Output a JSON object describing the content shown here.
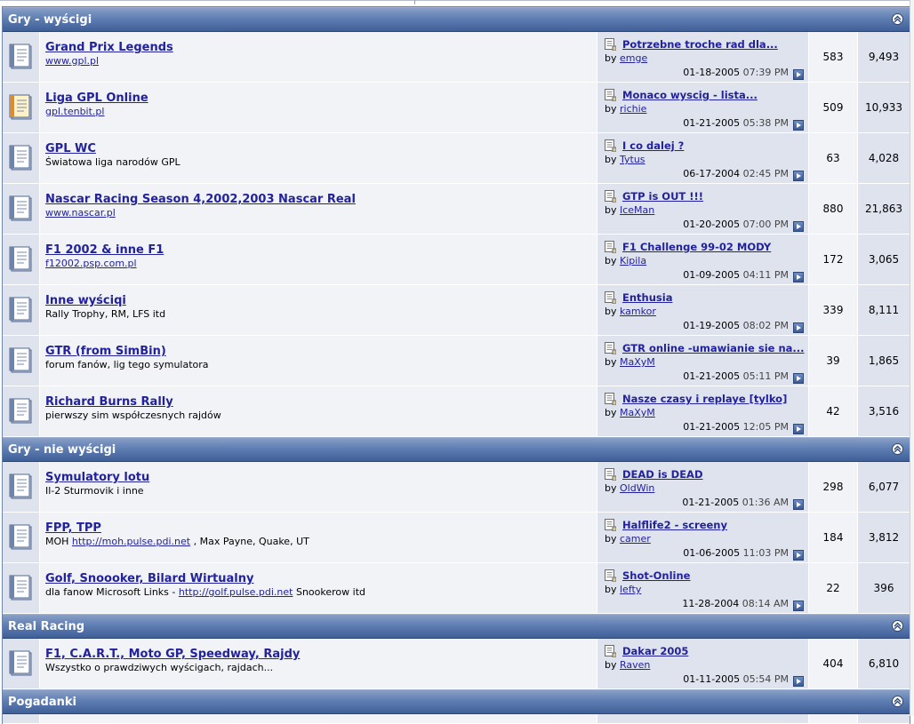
{
  "sections": [
    {
      "title": "Gry - wyścigi",
      "forums": [
        {
          "name": "Grand Prix Legends",
          "desc_link": "www.gpl.pl",
          "desc_text": "",
          "desc_after": "",
          "last_title": "Potrzebne troche rad dla...",
          "last_user": "emge",
          "last_date": "01-18-2005",
          "last_time": "07:39 PM",
          "threads": "583",
          "posts": "9,493",
          "icon": "forum-icon"
        },
        {
          "name": "Liga GPL Online",
          "desc_link": "gpl.tenbit.pl",
          "desc_text": "",
          "desc_after": "",
          "last_title": "Monaco wyscig - lista...",
          "last_user": "richie",
          "last_date": "01-21-2005",
          "last_time": "05:38 PM",
          "threads": "509",
          "posts": "10,933",
          "icon": "forum-new-posts-icon"
        },
        {
          "name": "GPL WC",
          "desc_link": "",
          "desc_text": "Światowa liga narodów GPL",
          "desc_after": "",
          "last_title": "I co dalej ?",
          "last_user": "Tytus",
          "last_date": "06-17-2004",
          "last_time": "02:45 PM",
          "threads": "63",
          "posts": "4,028",
          "icon": "forum-icon"
        },
        {
          "name": "Nascar Racing Season 4,2002,2003 Nascar Real",
          "desc_link": "www.nascar.pl",
          "desc_text": "",
          "desc_after": "",
          "last_title": "GTP is OUT !!!",
          "last_user": "IceMan",
          "last_date": "01-20-2005",
          "last_time": "07:00 PM",
          "threads": "880",
          "posts": "21,863",
          "icon": "forum-icon"
        },
        {
          "name": "F1 2002 & inne F1",
          "desc_link": "f12002.psp.com.pl",
          "desc_text": "",
          "desc_after": "",
          "last_title": "F1 Challenge 99-02 MODY",
          "last_user": "Kipila",
          "last_date": "01-09-2005",
          "last_time": "04:11 PM",
          "threads": "172",
          "posts": "3,065",
          "icon": "forum-icon"
        },
        {
          "name": "Inne wyściqi",
          "desc_link": "",
          "desc_text": "Rally Trophy, RM, LFS itd",
          "desc_after": "",
          "last_title": "Enthusia",
          "last_user": "kamkor",
          "last_date": "01-19-2005",
          "last_time": "08:02 PM",
          "threads": "339",
          "posts": "8,111",
          "icon": "forum-icon"
        },
        {
          "name": "GTR (from SimBin)",
          "desc_link": "",
          "desc_text": "forum fanów, lig tego symulatora",
          "desc_after": "",
          "last_title": "GTR online -umawianie sie na...",
          "last_user": "MaXyM",
          "last_date": "01-21-2005",
          "last_time": "05:11 PM",
          "threads": "39",
          "posts": "1,865",
          "icon": "forum-icon"
        },
        {
          "name": "Richard Burns Rally",
          "desc_link": "",
          "desc_text": "pierwszy sim współczesnych rajdów",
          "desc_after": "",
          "last_title": "Nasze czasy i replaye [tylko]",
          "last_user": "MaXyM",
          "last_date": "01-21-2005",
          "last_time": "12:05 PM",
          "threads": "42",
          "posts": "3,516",
          "icon": "forum-icon"
        }
      ]
    },
    {
      "title": "Gry - nie wyścigi",
      "forums": [
        {
          "name": "Symulatory lotu",
          "desc_link": "",
          "desc_text": "Il-2 Sturmovik i inne",
          "desc_after": "",
          "last_title": "DEAD is DEAD",
          "last_user": "OldWin",
          "last_date": "01-21-2005",
          "last_time": "01:36 AM",
          "threads": "298",
          "posts": "6,077",
          "icon": "forum-icon"
        },
        {
          "name": "FPP, TPP",
          "desc_link": "http://moh.pulse.pdi.net",
          "desc_text": "MOH ",
          "desc_after": " , Max Payne, Quake, UT",
          "last_title": "Halflife2 - screeny",
          "last_user": "camer",
          "last_date": "01-06-2005",
          "last_time": "11:03 PM",
          "threads": "184",
          "posts": "3,812",
          "icon": "forum-icon"
        },
        {
          "name": "Golf, Snoooker, Bilard Wirtualny",
          "desc_link": "http://golf.pulse.pdi.net",
          "desc_text": "dla fanow Microsoft Links - ",
          "desc_after": " Snookerow itd",
          "last_title": "Shot-Online",
          "last_user": "lefty",
          "last_date": "11-28-2004",
          "last_time": "08:14 AM",
          "threads": "22",
          "posts": "396",
          "icon": "forum-icon"
        }
      ]
    },
    {
      "title": "Real Racing",
      "forums": [
        {
          "name": "F1, C.A.R.T., Moto GP, Speedway, Rajdy",
          "desc_link": "",
          "desc_text": "Wszystko o prawdziwych wyścigach, rajdach...",
          "desc_after": "",
          "last_title": "Dakar 2005",
          "last_user": "Raven",
          "last_date": "01-11-2005",
          "last_time": "05:54 PM",
          "threads": "404",
          "posts": "6,810",
          "icon": "forum-icon"
        }
      ]
    },
    {
      "title": "Pogadanki",
      "forums": []
    }
  ],
  "labels": {
    "by": "by"
  },
  "colors": {
    "link": "#22229c",
    "category_bar": "#4a6aa3",
    "alt1": "#f1f3f7",
    "alt2": "#dfe3ee"
  }
}
